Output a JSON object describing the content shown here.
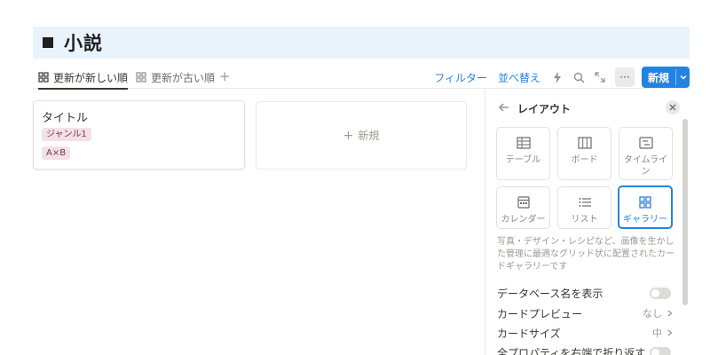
{
  "page": {
    "title": "小説"
  },
  "views": {
    "tabs": [
      {
        "label": "更新が新しい順",
        "active": true
      },
      {
        "label": "更新が古い順",
        "active": false
      }
    ],
    "add_tab": "+"
  },
  "toolbar": {
    "filter_label": "フィルター",
    "sort_label": "並べ替え",
    "more_label": "···",
    "new_label": "新規",
    "icons": [
      "lightning-icon",
      "search-icon",
      "expand-icon"
    ]
  },
  "gallery": {
    "cards": [
      {
        "title": "タイトル",
        "tags": [
          "ジャンル1",
          "A×B"
        ]
      }
    ],
    "new_card_label": "新規"
  },
  "layout_panel": {
    "title": "レイアウト",
    "options": [
      {
        "label": "テーブル",
        "icon": "table-icon",
        "selected": false
      },
      {
        "label": "ボード",
        "icon": "board-icon",
        "selected": false
      },
      {
        "label": "タイムライン",
        "icon": "timeline-icon",
        "selected": false
      },
      {
        "label": "カレンダー",
        "icon": "calendar-icon",
        "selected": false
      },
      {
        "label": "リスト",
        "icon": "list-icon",
        "selected": false
      },
      {
        "label": "ギャラリー",
        "icon": "gallery-icon",
        "selected": true
      }
    ],
    "description": "写真・デザイン・レシピなど、画像を生かした管理に最適なグリッド状に配置されたカードギャラリーです",
    "settings": [
      {
        "label": "データベース名を表示",
        "type": "toggle",
        "on": false
      },
      {
        "label": "カードプレビュー",
        "type": "select",
        "value": "なし"
      },
      {
        "label": "カードサイズ",
        "type": "select",
        "value": "中"
      },
      {
        "label": "全プロパティを右端で折り返す",
        "type": "toggle",
        "on": false
      }
    ]
  },
  "colors": {
    "accent": "#2383e2",
    "title_bg": "#e9f3fb",
    "tag_bg": "#f5e0e9"
  }
}
